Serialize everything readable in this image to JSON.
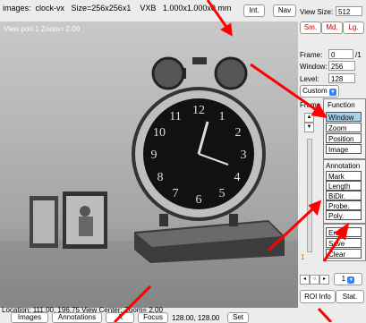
{
  "topbar": {
    "info": "images:  clock-vx   Size=256x256x1    VXB   1.000x1.000x0 mm",
    "int_label": "Int.",
    "nav_label": "Nav"
  },
  "viewport": {
    "label": "View port 1  Zoom= 2.00"
  },
  "status": {
    "location": "Location: 111.00, 196.75  View Center: Zoom= 2.00"
  },
  "bottombar": {
    "images": "Images",
    "annotations": "Annotations",
    "a": "A",
    "focus": "Focus",
    "center_value": "128.00, 128.00",
    "set": "Set"
  },
  "right": {
    "view_size_label": "View Size:",
    "view_size_value": "512",
    "size_sm": "Sm.",
    "size_md": "Md.",
    "size_lg": "Lg.",
    "frame_label": "Frame:",
    "frame_value": "0",
    "frame_total": "/1",
    "window_label": "Window:",
    "window_value": "256",
    "level_label": "Level:",
    "level_value": "128",
    "preset": "Custom",
    "frame_header": "Frame",
    "function_header": "Function",
    "functions": [
      "Window",
      "Zoom",
      "Position",
      "Image"
    ],
    "annotation_header": "Annotation",
    "annotations": [
      "Mark",
      "Length",
      "BiDir.",
      "Probe.",
      "Poly."
    ],
    "actions": [
      "Erase",
      "Save",
      "Clear"
    ],
    "slider_value": "1",
    "viewport_select": "1",
    "roi_info": "ROI Info",
    "stat": "Stat."
  },
  "colors": {
    "selected": "#a9d4ec",
    "accent_red": "#c00000",
    "arrow": "#ff0000"
  }
}
